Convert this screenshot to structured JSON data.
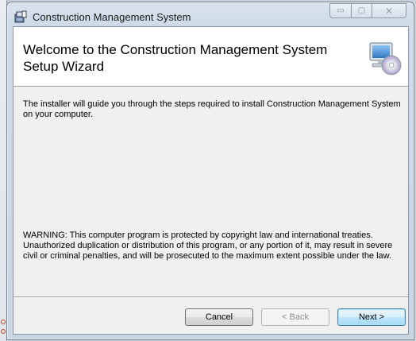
{
  "window": {
    "title": "Construction Management System"
  },
  "banner": {
    "title": "Welcome to the Construction Management System Setup Wizard",
    "icon": "computer-with-cd-icon"
  },
  "body": {
    "intro": "The installer will guide you through the steps required to install Construction Management System on your computer.",
    "warning": "WARNING: This computer program is protected by copyright law and international treaties. Unauthorized duplication or distribution of this program, or any portion of it, may result in severe civil or criminal penalties, and will be prosecuted to the maximum extent possible under the law."
  },
  "buttons": {
    "cancel": "Cancel",
    "back": "< Back",
    "next": "Next >"
  },
  "caption_buttons": {
    "minimize": "▭",
    "maximize": "▢",
    "close": "✕"
  }
}
